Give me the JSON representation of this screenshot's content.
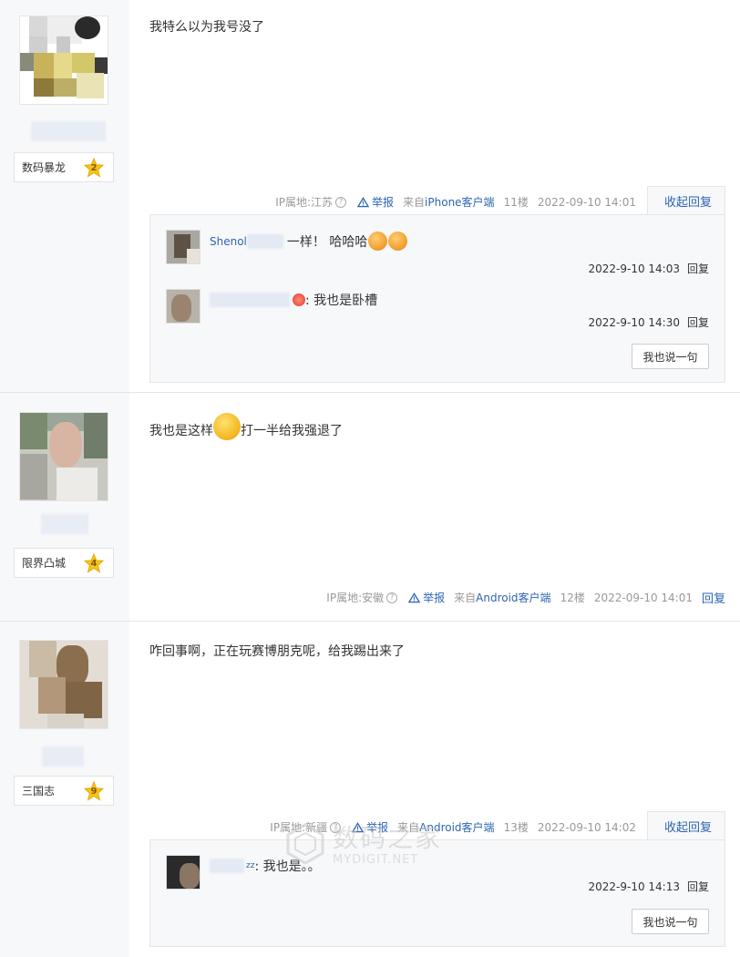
{
  "posts": [
    {
      "user_badge": "数码暴龙",
      "user_level": "2",
      "content": "我特么以为我号没了",
      "ip_location": "IP属地:江苏",
      "report": "举报",
      "client_prefix": "来自",
      "client_name": "iPhone客户端",
      "floor": "11楼",
      "time": "2022-09-10 14:01",
      "action": "收起回复",
      "replies": [
        {
          "user": "Shenol",
          "text": "一样！ 哈哈哈",
          "time": "2022-9-10 14:03",
          "reply": "回复"
        },
        {
          "user": "",
          "text": ": 我也是卧槽",
          "time": "2022-9-10 14:30",
          "reply": "回复"
        }
      ],
      "say_button": "我也说一句"
    },
    {
      "user_badge": "限界凸城",
      "user_level": "4",
      "content_before": "我也是这样",
      "content_after": "打一半给我强退了",
      "ip_location": "IP属地:安徽",
      "report": "举报",
      "client_prefix": "来自",
      "client_name": "Android客户端",
      "floor": "12楼",
      "time": "2022-09-10 14:01",
      "action": "回复"
    },
    {
      "user_badge": "三国志",
      "user_level": "9",
      "content": "咋回事啊，正在玩赛博朋克呢，给我踢出来了",
      "ip_location": "IP属地:新疆",
      "report": "举报",
      "client_prefix": "来自",
      "client_name": "Android客户端",
      "floor": "13楼",
      "time": "2022-09-10 14:02",
      "action": "收起回复",
      "replies": [
        {
          "user": "zz",
          "text": ": 我也是。。",
          "time": "2022-9-10 14:13",
          "reply": "回复"
        }
      ],
      "say_button": "我也说一句"
    }
  ],
  "watermark": {
    "title": "数码之家",
    "url": "MYDIGIT.NET"
  },
  "colors": {
    "link": "#2d64b3",
    "side_bg": "#f7f8fa",
    "star": "#f5c518"
  }
}
